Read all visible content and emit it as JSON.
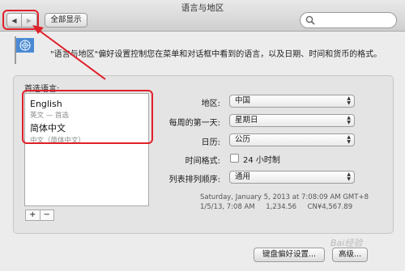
{
  "window": {
    "title": "语言与地区"
  },
  "toolbar": {
    "back_icon": "◀",
    "forward_icon": "▶",
    "show_all_label": "全部显示",
    "search_placeholder": ""
  },
  "header": {
    "description": "\"语言与地区\"偏好设置控制您在菜单和对话框中看到的语言，以及日期、时间和货币的格式。"
  },
  "languages": {
    "label": "首选语言:",
    "items": [
      {
        "name": "English",
        "sub": "英文 — 首选"
      },
      {
        "name": "简体中文",
        "sub": "中文（简体中文）"
      }
    ],
    "add_label": "+",
    "remove_label": "−"
  },
  "settings": {
    "region_label": "地区:",
    "region_value": "中国",
    "first_day_label": "每周的第一天:",
    "first_day_value": "星期日",
    "calendar_label": "日历:",
    "calendar_value": "公历",
    "time_format_label": "时间格式:",
    "time_format_checkbox": "24 小时制",
    "sort_order_label": "列表排列顺序:",
    "sort_order_value": "通用"
  },
  "format_preview": {
    "line1": "Saturday, January 5, 2013 at 7:08:09 AM GMT+8",
    "line2": "1/5/13, 7:08 AM     1,234.56     CN¥4,567.89"
  },
  "footer": {
    "keyboard_button": "键盘偏好设置...",
    "advanced_button": "高级..."
  },
  "watermark": {
    "text": "Bai经验"
  },
  "colors": {
    "highlight": "#e0202a"
  }
}
